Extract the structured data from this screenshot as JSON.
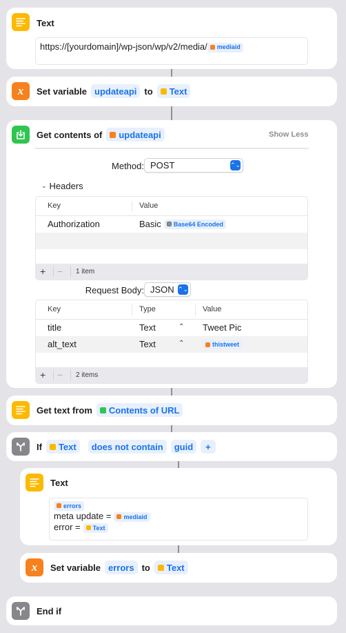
{
  "actions": {
    "text1": {
      "title": "Text",
      "icon": "text-lines-icon",
      "content_prefix": "https://[yourdomain]/wp-json/wp/v2/media/",
      "content_var": "mediaid"
    },
    "setvar1": {
      "title": "Set variable",
      "icon": "variable-x-icon",
      "variable": "updateapi",
      "to": "to",
      "value": "Text"
    },
    "getcontents": {
      "title": "Get contents of",
      "icon": "download-icon",
      "target": "updateapi",
      "show_less": "Show Less",
      "method_label": "Method:",
      "method_value": "POST",
      "headers_label": "Headers",
      "headers_table": {
        "columns": [
          "Key",
          "Value"
        ],
        "rows": [
          {
            "key": "Authorization",
            "value_prefix": "Basic",
            "value_var": "Base64 Encoded"
          }
        ],
        "count": "1 item"
      },
      "body_label": "Request Body:",
      "body_value": "JSON",
      "body_table": {
        "columns": [
          "Key",
          "Type",
          "Value"
        ],
        "rows": [
          {
            "key": "title",
            "type": "Text",
            "value": "Tweet Pic"
          },
          {
            "key": "alt_text",
            "type": "Text",
            "value_var": "thistweet"
          }
        ],
        "count": "2 items"
      }
    },
    "gettext": {
      "title": "Get text from",
      "icon": "text-lines-icon",
      "source": "Contents of URL"
    },
    "if": {
      "title": "If",
      "icon": "branch-icon",
      "input": "Text",
      "condition": "does not contain",
      "value": "guid",
      "add": "+"
    },
    "text2": {
      "title": "Text",
      "icon": "text-lines-icon",
      "line1_var": "errors",
      "line2_prefix": "meta update =",
      "line2_var": "mediaid",
      "line3_prefix": "error =",
      "line3_var": "Text"
    },
    "setvar2": {
      "title": "Set variable",
      "icon": "variable-x-icon",
      "variable": "errors",
      "to": "to",
      "value": "Text"
    },
    "endif": {
      "title": "End if",
      "icon": "branch-icon"
    }
  },
  "colors": {
    "accent": "#1a73e8",
    "text_action": "#fcb900",
    "variable_action": "#f7811d",
    "web_action": "#2fc54e",
    "control_action": "#86868b",
    "background": "#e3e3e8"
  }
}
